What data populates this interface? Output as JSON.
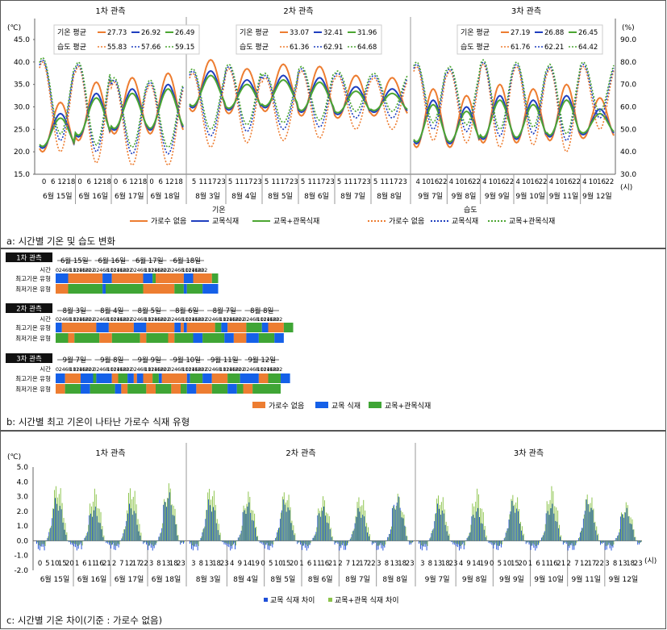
{
  "panel_a": {
    "caption": "a: 시간별 기온 및 습도 변화",
    "obs_titles": [
      "1차 관측",
      "2차 관측",
      "3차 관측"
    ],
    "left_unit": "(℃)",
    "right_unit": "(%)",
    "sub_labels": [
      "기온",
      "습도"
    ],
    "time_unit": "(시)",
    "avg_boxes": [
      {
        "temp_label": "기온 평균",
        "temp": [
          "27.73",
          "26.92",
          "26.49"
        ],
        "hum_label": "습도 평균",
        "hum": [
          "55.83",
          "57.66",
          "59.15"
        ]
      },
      {
        "temp_label": "기온 평균",
        "temp": [
          "33.07",
          "32.41",
          "31.96"
        ],
        "hum_label": "습도 평균",
        "hum": [
          "61.36",
          "62.91",
          "64.68"
        ]
      },
      {
        "temp_label": "기온 평균",
        "temp": [
          "27.19",
          "26.88",
          "26.45"
        ],
        "hum_label": "습도 평균",
        "hum": [
          "61.76",
          "62.21",
          "64.42"
        ]
      }
    ],
    "legend": [
      "가로수 없음",
      "교목식재",
      "교목+관목식재",
      "가로수 없음",
      "교목식재",
      "교목+관목식재"
    ],
    "colors": {
      "none": "#ED7D31",
      "tree": "#1F3FBF",
      "treeshrub": "#4CA632"
    }
  },
  "panel_b": {
    "caption": "b: 시간별 최고 기온이 나타난 가로수 식재 유형",
    "row_labels": [
      "시간",
      "최고기온 유형",
      "최저기온 유형"
    ],
    "obs_tags": [
      "1차 관측",
      "2차 관측",
      "3차 관측"
    ],
    "days": [
      [
        "6월 15일",
        "6월 16일",
        "6월 17일",
        "6월 18일"
      ],
      [
        "8월 3일",
        "8월 4일",
        "8월 5일",
        "8월 6일",
        "8월 7일",
        "8월 8일"
      ],
      [
        "9월 7일",
        "9월 8일",
        "9월 9일",
        "9월 10일",
        "9월 11일",
        "9월 12일"
      ]
    ],
    "hour_ticks": [
      "0",
      "2",
      "4",
      "6",
      "8",
      "10",
      "12",
      "14",
      "16",
      "18",
      "20",
      "22"
    ],
    "legend": [
      "가로수 없음",
      "교목 식재",
      "교목+관목식재"
    ],
    "colors": {
      "none": "#ED7D31",
      "tree": "#1560E8",
      "treeshrub": "#3FA535"
    }
  },
  "panel_c": {
    "caption": "c: 시간별 기온 차이(기준 : 가로수 없음)",
    "unit": "(℃)",
    "time_unit": "(시)",
    "legend": [
      "교목 식재 차이",
      "교목+관목 식재 차이"
    ],
    "colors": {
      "tree": "#1F4FD8",
      "treeshrub": "#8BC34A"
    }
  },
  "chart_data": [
    {
      "type": "line",
      "panel": "a",
      "title": "",
      "ylabel_left": "(℃)",
      "ylabel_right": "(%)",
      "ylim_left": [
        15,
        45
      ],
      "yticks_left": [
        "15.0",
        "20.0",
        "25.0",
        "30.0",
        "35.0",
        "40.0",
        "45.0"
      ],
      "ylim_right": [
        30,
        90
      ],
      "yticks_right": [
        "30.0",
        "40.0",
        "50.0",
        "60.0",
        "70.0",
        "80.0",
        "90.0"
      ],
      "groups": [
        {
          "name": "1차 관측",
          "start_hour": 0,
          "days": [
            "6월 15일",
            "6월 16일",
            "6월 17일",
            "6월 18일"
          ],
          "hour_ticks": [
            "0",
            "6",
            "12",
            "18",
            "0",
            "6",
            "12",
            "18",
            "0",
            "6",
            "12",
            "18",
            "0",
            "6",
            "12",
            "18"
          ],
          "temp_max": [
            31.0,
            35.5,
            36.5,
            37.5
          ],
          "temp_min": [
            20.0,
            22.5,
            24.0,
            24.0
          ],
          "hum_max": [
            80.0,
            78.0,
            71.0,
            70.0
          ],
          "hum_min": [
            40.0,
            35.0,
            34.0,
            34.0
          ]
        },
        {
          "name": "2차 관측",
          "start_hour": 0,
          "days": [
            "8월 3일",
            "8월 4일",
            "8월 5일",
            "8월 6일",
            "8월 7일",
            "8월 8일"
          ],
          "hour_ticks": [
            "5",
            "11",
            "17",
            "23",
            "5",
            "11",
            "17",
            "23",
            "5",
            "11",
            "17",
            "23",
            "5",
            "11",
            "17",
            "23",
            "5",
            "11",
            "17",
            "23",
            "5",
            "11",
            "17",
            "23"
          ],
          "temp_max": [
            40.5,
            38.5,
            39.5,
            39.0,
            37.0,
            36.5
          ],
          "temp_min": [
            29.0,
            28.5,
            29.0,
            28.0,
            27.5,
            28.0
          ],
          "hum_max": [
            75.0,
            77.0,
            73.0,
            76.0,
            74.0,
            73.0
          ],
          "hum_min": [
            42.0,
            44.0,
            45.0,
            46.0,
            50.0,
            50.0
          ]
        },
        {
          "name": "3차 관측",
          "start_hour": 0,
          "days": [
            "9월 7일",
            "9월 8일",
            "9월 9일",
            "9월 10일",
            "9월 11일",
            "9월 12일"
          ],
          "hour_ticks": [
            "4",
            "10",
            "16",
            "22",
            "4",
            "10",
            "16",
            "22",
            "4",
            "10",
            "16",
            "22",
            "4",
            "10",
            "16",
            "22",
            "4",
            "10",
            "16",
            "22",
            "4",
            "10",
            "16",
            "22"
          ],
          "temp_max": [
            34.0,
            32.5,
            35.0,
            34.0,
            35.0,
            32.0
          ],
          "temp_min": [
            21.0,
            21.0,
            22.0,
            22.0,
            22.5,
            23.0
          ],
          "hum_max": [
            78.0,
            76.0,
            79.0,
            78.0,
            77.0,
            78.0
          ],
          "hum_min": [
            45.0,
            44.0,
            42.0,
            43.0,
            40.0,
            50.0
          ]
        }
      ],
      "series": [
        {
          "name": "가로수 없음",
          "kind": "temp",
          "key": "none",
          "peak_offset": 0,
          "trough_offset": 0
        },
        {
          "name": "교목식재",
          "kind": "temp",
          "key": "tree",
          "peak_offset": -2.5,
          "trough_offset": 0.8
        },
        {
          "name": "교목+관목식재",
          "kind": "temp",
          "key": "treeshrub",
          "peak_offset": -3.5,
          "trough_offset": 1.2
        },
        {
          "name": "가로수 없음",
          "kind": "hum",
          "key": "none",
          "peak_offset": 0,
          "trough_offset": 0
        },
        {
          "name": "교목식재",
          "kind": "hum",
          "key": "tree",
          "peak_offset": 1,
          "trough_offset": 5
        },
        {
          "name": "교목+관목식재",
          "kind": "hum",
          "key": "treeshrub",
          "peak_offset": 2,
          "trough_offset": 8
        }
      ]
    },
    {
      "type": "heatmap",
      "panel": "b",
      "title": "",
      "categories": [
        "none",
        "tree",
        "treeshrub"
      ],
      "rows": [
        {
          "group": 0,
          "kind": "max",
          "runs": [
            [
              "tree",
              8
            ],
            [
              "none",
              22
            ],
            [
              "tree",
              6
            ],
            [
              "none",
              20
            ],
            [
              "tree",
              6
            ],
            [
              "treeshrub",
              2
            ],
            [
              "none",
              18
            ],
            [
              "tree",
              6
            ],
            [
              "none",
              12
            ],
            [
              "treeshrub",
              4
            ]
          ]
        },
        {
          "group": 0,
          "kind": "min",
          "runs": [
            [
              "none",
              8
            ],
            [
              "treeshrub",
              22
            ],
            [
              "tree",
              2
            ],
            [
              "treeshrub",
              24
            ],
            [
              "none",
              20
            ],
            [
              "treeshrub",
              6
            ],
            [
              "tree",
              2
            ],
            [
              "treeshrub",
              10
            ],
            [
              "tree",
              10
            ]
          ]
        },
        {
          "group": 1,
          "kind": "max",
          "runs": [
            [
              "tree",
              4
            ],
            [
              "none",
              22
            ],
            [
              "tree",
              8
            ],
            [
              "none",
              16
            ],
            [
              "tree",
              8
            ],
            [
              "none",
              18
            ],
            [
              "tree",
              4
            ],
            [
              "none",
              2
            ],
            [
              "tree",
              2
            ],
            [
              "none",
              18
            ],
            [
              "treeshrub",
              4
            ],
            [
              "tree",
              4
            ],
            [
              "none",
              12
            ],
            [
              "treeshrub",
              10
            ],
            [
              "tree",
              4
            ],
            [
              "none",
              10
            ],
            [
              "treeshrub",
              6
            ]
          ]
        },
        {
          "group": 1,
          "kind": "min",
          "runs": [
            [
              "treeshrub",
              8
            ],
            [
              "none",
              4
            ],
            [
              "treeshrub",
              16
            ],
            [
              "none",
              8
            ],
            [
              "treeshrub",
              18
            ],
            [
              "none",
              4
            ],
            [
              "treeshrub",
              14
            ],
            [
              "none",
              4
            ],
            [
              "treeshrub",
              12
            ],
            [
              "tree",
              6
            ],
            [
              "treeshrub",
              14
            ],
            [
              "tree",
              6
            ],
            [
              "none",
              8
            ],
            [
              "tree",
              8
            ],
            [
              "treeshrub",
              10
            ],
            [
              "tree",
              6
            ]
          ]
        },
        {
          "group": 2,
          "kind": "max",
          "runs": [
            [
              "tree",
              6
            ],
            [
              "none",
              10
            ],
            [
              "tree",
              8
            ],
            [
              "treeshrub",
              2
            ],
            [
              "tree",
              10
            ],
            [
              "none",
              4
            ],
            [
              "treeshrub",
              6
            ],
            [
              "tree",
              4
            ],
            [
              "none",
              2
            ],
            [
              "tree",
              4
            ],
            [
              "none",
              6
            ],
            [
              "treeshrub",
              4
            ],
            [
              "tree",
              2
            ],
            [
              "none",
              16
            ],
            [
              "tree",
              2
            ],
            [
              "treeshrub",
              8
            ],
            [
              "tree",
              6
            ],
            [
              "none",
              10
            ],
            [
              "treeshrub",
              8
            ],
            [
              "tree",
              12
            ],
            [
              "none",
              6
            ],
            [
              "treeshrub",
              8
            ],
            [
              "tree",
              6
            ]
          ]
        },
        {
          "group": 2,
          "kind": "min",
          "runs": [
            [
              "none",
              6
            ],
            [
              "treeshrub",
              10
            ],
            [
              "tree",
              6
            ],
            [
              "treeshrub",
              16
            ],
            [
              "tree",
              4
            ],
            [
              "none",
              4
            ],
            [
              "treeshrub",
              12
            ],
            [
              "none",
              6
            ],
            [
              "treeshrub",
              10
            ],
            [
              "none",
              6
            ],
            [
              "treeshrub",
              4
            ],
            [
              "tree",
              6
            ],
            [
              "none",
              10
            ],
            [
              "treeshrub",
              10
            ],
            [
              "tree",
              6
            ],
            [
              "treeshrub",
              4
            ],
            [
              "none",
              6
            ],
            [
              "treeshrub",
              18
            ]
          ]
        }
      ]
    },
    {
      "type": "bar",
      "panel": "c",
      "title": "",
      "ylabel": "(℃)",
      "ylim": [
        -2,
        5
      ],
      "yticks": [
        "-2.0",
        "-1.0",
        "0.0",
        "1.0",
        "2.0",
        "3.0",
        "4.0",
        "5.0"
      ],
      "groups": [
        {
          "name": "1차 관측",
          "days": [
            "6월 15일",
            "6월 16일",
            "6월 17일",
            "6월 18일"
          ],
          "hour_ticks": [
            "0",
            "5",
            "10",
            "15",
            "20",
            "1",
            "6",
            "11",
            "16",
            "21",
            "2",
            "7",
            "12",
            "17",
            "22",
            "3",
            "8",
            "13",
            "18",
            "23"
          ],
          "tree_peak": [
            3.0,
            2.4,
            2.6,
            3.4
          ],
          "treeshrub_peak": [
            4.1,
            3.6,
            3.9,
            4.0
          ]
        },
        {
          "name": "2차 관측",
          "days": [
            "8월 3일",
            "8월 4일",
            "8월 5일",
            "8월 6일",
            "8월 7일",
            "8월 8일"
          ],
          "hour_ticks": [
            "3",
            "8",
            "13",
            "18",
            "23",
            "4",
            "9",
            "14",
            "19",
            "0",
            "5",
            "10",
            "15",
            "20",
            "1",
            "6",
            "11",
            "16",
            "21",
            "2",
            "7",
            "12",
            "17",
            "22",
            "3",
            "8",
            "13",
            "18",
            "23"
          ],
          "tree_peak": [
            2.9,
            2.7,
            2.9,
            2.4,
            2.3,
            3.1
          ],
          "treeshrub_peak": [
            3.9,
            3.4,
            3.6,
            3.1,
            3.2,
            3.3
          ]
        },
        {
          "name": "3차 관측",
          "days": [
            "9월 7일",
            "9월 8일",
            "9월 9일",
            "9월 10일",
            "9월 11일",
            "9월 12일"
          ],
          "hour_ticks": [
            "3",
            "8",
            "13",
            "18",
            "23",
            "4",
            "9",
            "14",
            "19",
            "0",
            "5",
            "10",
            "15",
            "20",
            "1",
            "6",
            "11",
            "16",
            "21",
            "2",
            "7",
            "12",
            "17",
            "22",
            "3",
            "8",
            "13",
            "18",
            "23"
          ],
          "tree_peak": [
            2.6,
            2.3,
            2.8,
            2.6,
            2.9,
            2.3
          ],
          "treeshrub_peak": [
            3.4,
            3.6,
            3.4,
            3.8,
            3.4,
            2.7
          ]
        }
      ],
      "series": [
        {
          "name": "교목 식재 차이",
          "key": "tree",
          "night_min": -1.1
        },
        {
          "name": "교목+관목 식재 차이",
          "key": "treeshrub",
          "night_min": -0.6
        }
      ]
    }
  ]
}
